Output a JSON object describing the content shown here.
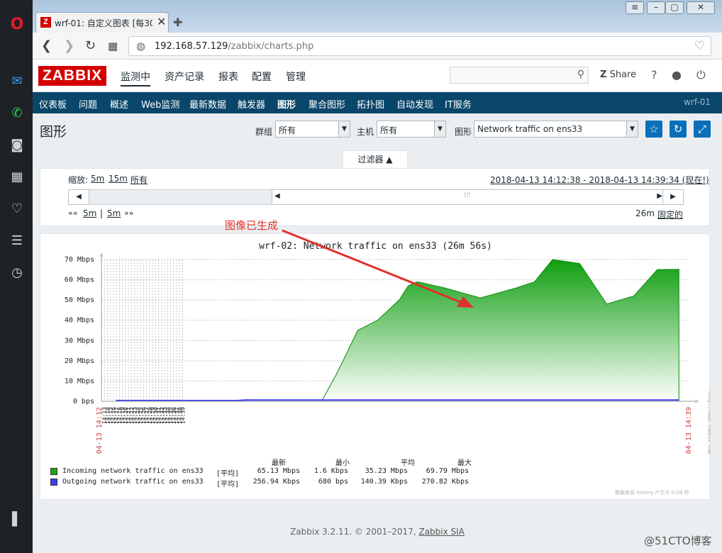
{
  "browser": {
    "tab_title": "wrf-01: 自定义图表 [每30",
    "tab_favicon": "Z",
    "url_host": "192.168.57.129",
    "url_path": "/zabbix/charts.php"
  },
  "header": {
    "logo": "ZABBIX",
    "menu": [
      "监测中",
      "资产记录",
      "报表",
      "配置",
      "管理"
    ],
    "share": "Share",
    "help": "?"
  },
  "subnav": {
    "items": [
      "仪表板",
      "问题",
      "概述",
      "Web监测",
      "最新数据",
      "触发器",
      "图形",
      "聚合图形",
      "拓扑图",
      "自动发现",
      "IT服务"
    ],
    "active": "图形",
    "right": "wrf-01"
  },
  "page": {
    "title": "图形",
    "group_label": "群组",
    "group_value": "所有",
    "host_label": "主机",
    "host_value": "所有",
    "graph_label": "图形",
    "graph_value": "Network traffic on ens33"
  },
  "filter": {
    "tab_label": "过滤器 ▲",
    "zoom_label": "缩放:",
    "zoom_5m": "5m",
    "zoom_15m": "15m",
    "zoom_all": "所有",
    "range": "2018-04-13 14:12:38 - 2018-04-13 14:39:34 (现在!)",
    "nav_prev": "««",
    "nav_5m_a": "5m",
    "nav_sep": "|",
    "nav_5m_b": "5m",
    "nav_next": "»»",
    "period": "26m",
    "fixed": "固定的"
  },
  "annotation": "图像已生成",
  "graph": {
    "title": "wrf-02: Network traffic on ens33 (26m 56s)",
    "side_watermark": "http://www.zabbix.com",
    "start_label": "04-13 14:12",
    "end_label": "04-13 14:39",
    "footer_watermark": "数据来自 history  产生于:0.09 秒",
    "legend_headers": [
      "最新",
      "最小",
      "平均",
      "最大"
    ],
    "legend_rows": [
      {
        "name": "Incoming network traffic on ens33",
        "func": "[平均]",
        "last": "65.13 Mbps",
        "min": "1.6 Kbps",
        "avg": "35.23 Mbps",
        "max": "69.79 Mbps"
      },
      {
        "name": "Outgoing network traffic on ens33",
        "func": "[平均]",
        "last": "256.94 Kbps",
        "min": "680 bps",
        "avg": "140.39 Kbps",
        "max": "270.82 Kbps"
      }
    ]
  },
  "chart_data": {
    "type": "area",
    "title": "wrf-02: Network traffic on ens33 (26m 56s)",
    "x": [
      "14:13",
      "14:14",
      "14:15",
      "14:16",
      "14:17",
      "14:18",
      "14:19",
      "14:20",
      "14:21",
      "14:22",
      "14:23",
      "14:24",
      "14:25",
      "14:26",
      "14:27",
      "14:28",
      "14:29",
      "14:30",
      "14:31",
      "14:32",
      "14:33",
      "14:34",
      "14:35",
      "14:36",
      "14:37",
      "14:38",
      "14:39"
    ],
    "ytick_labels": [
      "0 bps",
      "10 Mbps",
      "20 Mbps",
      "30 Mbps",
      "40 Mbps",
      "50 Mbps",
      "60 Mbps",
      "70 Mbps"
    ],
    "ylim": [
      0,
      70
    ],
    "y_unit": "Mbps",
    "grid": true,
    "series": [
      {
        "name": "Incoming network traffic on ens33",
        "color": "#1aa51a",
        "points": [
          [
            14.28,
            0
          ],
          [
            14.4,
            0
          ],
          [
            14.45,
            0
          ],
          [
            14.5,
            0
          ],
          [
            14.6,
            0
          ],
          [
            14.65,
            0
          ],
          [
            14.7,
            0
          ],
          [
            14.8,
            0
          ],
          [
            14.9,
            0
          ],
          [
            14.95,
            0
          ],
          [
            15,
            0
          ],
          [
            15.1,
            0
          ],
          [
            15.2,
            0
          ],
          [
            15.3,
            0
          ],
          [
            15.4,
            0
          ],
          [
            15.42,
            0.01
          ],
          [
            15.5,
            13
          ],
          [
            15.55,
            22
          ],
          [
            15.62,
            35
          ],
          [
            15.73,
            40
          ],
          [
            15.85,
            50
          ],
          [
            15.9,
            57
          ],
          [
            15.95,
            59
          ],
          [
            16.1,
            56
          ],
          [
            16.3,
            51
          ],
          [
            16.5,
            56
          ],
          [
            16.6,
            59
          ],
          [
            16.7,
            70
          ],
          [
            16.85,
            68
          ],
          [
            17.0,
            48
          ],
          [
            17.15,
            52
          ],
          [
            17.28,
            65
          ],
          [
            17.4,
            65.13
          ]
        ]
      },
      {
        "name": "Outgoing network traffic on ens33",
        "color": "#3c3cf0",
        "points": [
          [
            14.28,
            0
          ],
          [
            14.95,
            0
          ],
          [
            15.0,
            0.26
          ],
          [
            17.4,
            0.26
          ]
        ]
      }
    ]
  },
  "footer": {
    "text": "Zabbix 3.2.11. © 2001–2017, ",
    "link": "Zabbix SIA",
    "corner": "@51CTO博客"
  },
  "colors": {
    "brand": "#d40000",
    "subnav": "#0a466a",
    "accent": "#0a6fb8",
    "incoming": "#1aa51a",
    "outgoing": "#3c3cf0",
    "annotation": "#e0302c"
  }
}
